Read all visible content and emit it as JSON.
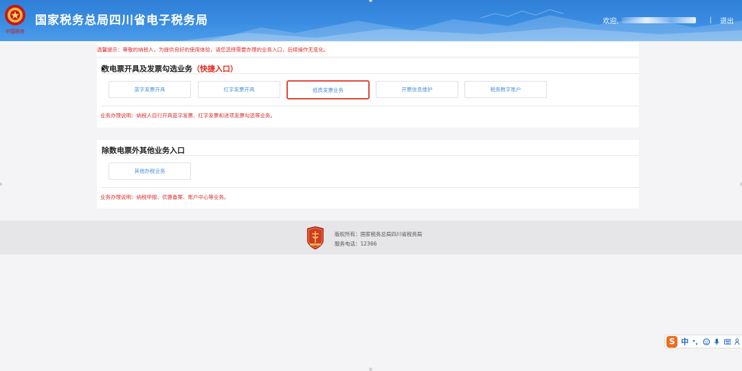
{
  "header": {
    "title": "国家税务总局四川省电子税务局",
    "welcome": "欢迎,",
    "separator": "|",
    "logout": "退出"
  },
  "notice": {
    "text": "温馨提示：尊敬的纳税人，为提供良好的使用体验，请您选择需要办理的业务入口，后续操作无变化。"
  },
  "section1": {
    "title": "数电票开具及发票勾选业务",
    "title_highlight": "（快捷入口）",
    "buttons": [
      "蓝字发票开具",
      "红字发票开具",
      "纸质发票业务",
      "开票信息维护",
      "税务数字账户"
    ],
    "active_button": "纸质发票业务",
    "description": "业务办理说明：纳税人自行开具蓝字发票、红字发票和进项发票勾选等业务。"
  },
  "section2": {
    "title": "除数电票外其他业务入口",
    "buttons": [
      "其他办税业务"
    ],
    "description": "业务办理说明：纳税申报、优惠备案、账户中心等业务。"
  },
  "footer": {
    "copyright": "版权所有：国家税务总局四川省税务局",
    "phone": "服务电话：12366"
  },
  "ime": {
    "logo": "S",
    "mode": "中"
  },
  "colors": {
    "header_blue": "#3a8de3",
    "accent_red": "#e0281f",
    "link_blue": "#4a90d9"
  }
}
